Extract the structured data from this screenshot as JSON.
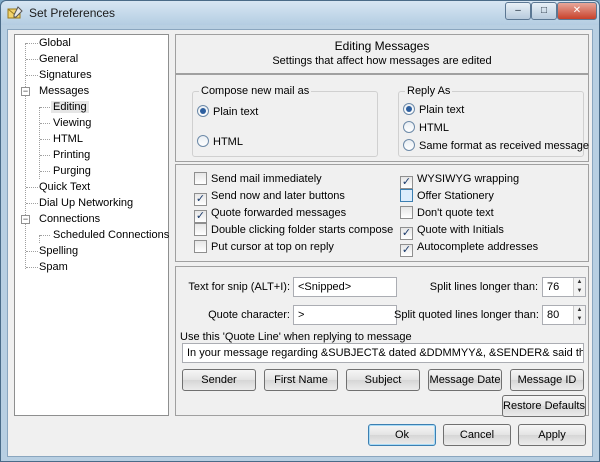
{
  "window": {
    "title": "Set Preferences",
    "minimize": "–",
    "maximize": "□",
    "close": "✕"
  },
  "tree": {
    "items": [
      {
        "label": "Global"
      },
      {
        "label": "General"
      },
      {
        "label": "Signatures"
      },
      {
        "label": "Messages"
      },
      {
        "label": "Editing"
      },
      {
        "label": "Viewing"
      },
      {
        "label": "HTML"
      },
      {
        "label": "Printing"
      },
      {
        "label": "Purging"
      },
      {
        "label": "Quick Text"
      },
      {
        "label": "Dial Up Networking"
      },
      {
        "label": "Connections"
      },
      {
        "label": "Scheduled Connections"
      },
      {
        "label": "Spelling"
      },
      {
        "label": "Spam"
      }
    ],
    "expander_minus": "−"
  },
  "header": {
    "title": "Editing Messages",
    "subtitle": "Settings that affect how messages are edited"
  },
  "compose": {
    "legend": "Compose new mail as",
    "options": [
      {
        "label": "Plain text",
        "selected": true
      },
      {
        "label": "HTML",
        "selected": false
      }
    ]
  },
  "reply": {
    "legend": "Reply As",
    "options": [
      {
        "label": "Plain text",
        "selected": true
      },
      {
        "label": "HTML",
        "selected": false
      },
      {
        "label": "Same format as received message",
        "selected": false
      }
    ]
  },
  "checkboxes": {
    "left": [
      {
        "label": "Send mail immediately",
        "checked": false
      },
      {
        "label": "Send now and later buttons",
        "checked": true
      },
      {
        "label": "Quote forwarded messages",
        "checked": true
      },
      {
        "label": "Double clicking folder starts compose",
        "checked": false
      },
      {
        "label": "Put cursor at top on reply",
        "checked": false
      }
    ],
    "right": [
      {
        "label": "WYSIWYG wrapping",
        "checked": true
      },
      {
        "label": "Offer Stationery",
        "checked": false
      },
      {
        "label": "Don't quote text",
        "checked": false
      },
      {
        "label": "Quote with Initials",
        "checked": true
      },
      {
        "label": "Autocomplete addresses",
        "checked": true
      }
    ],
    "check_glyph": "✓"
  },
  "fields": {
    "snip_label": "Text for snip (ALT+I):",
    "snip_value": "<Snipped>",
    "quote_char_label": "Quote character:",
    "quote_char_value": ">",
    "split_label": "Split lines longer than:",
    "split_value": "76",
    "split_quoted_label": "Split quoted lines longer than:",
    "split_quoted_value": "80",
    "spin_up": "▲",
    "spin_down": "▼",
    "quote_line_label": "Use this 'Quote Line' when replying to message",
    "quote_line_value": "In your message regarding &SUBJECT& dated &DDMMYY&, &SENDER& said that ..."
  },
  "insert_buttons": [
    "Sender",
    "First Name",
    "Subject",
    "Message Date",
    "Message ID"
  ],
  "restore_label": "Restore Defaults",
  "dialog_buttons": {
    "ok": "Ok",
    "cancel": "Cancel",
    "apply": "Apply"
  }
}
